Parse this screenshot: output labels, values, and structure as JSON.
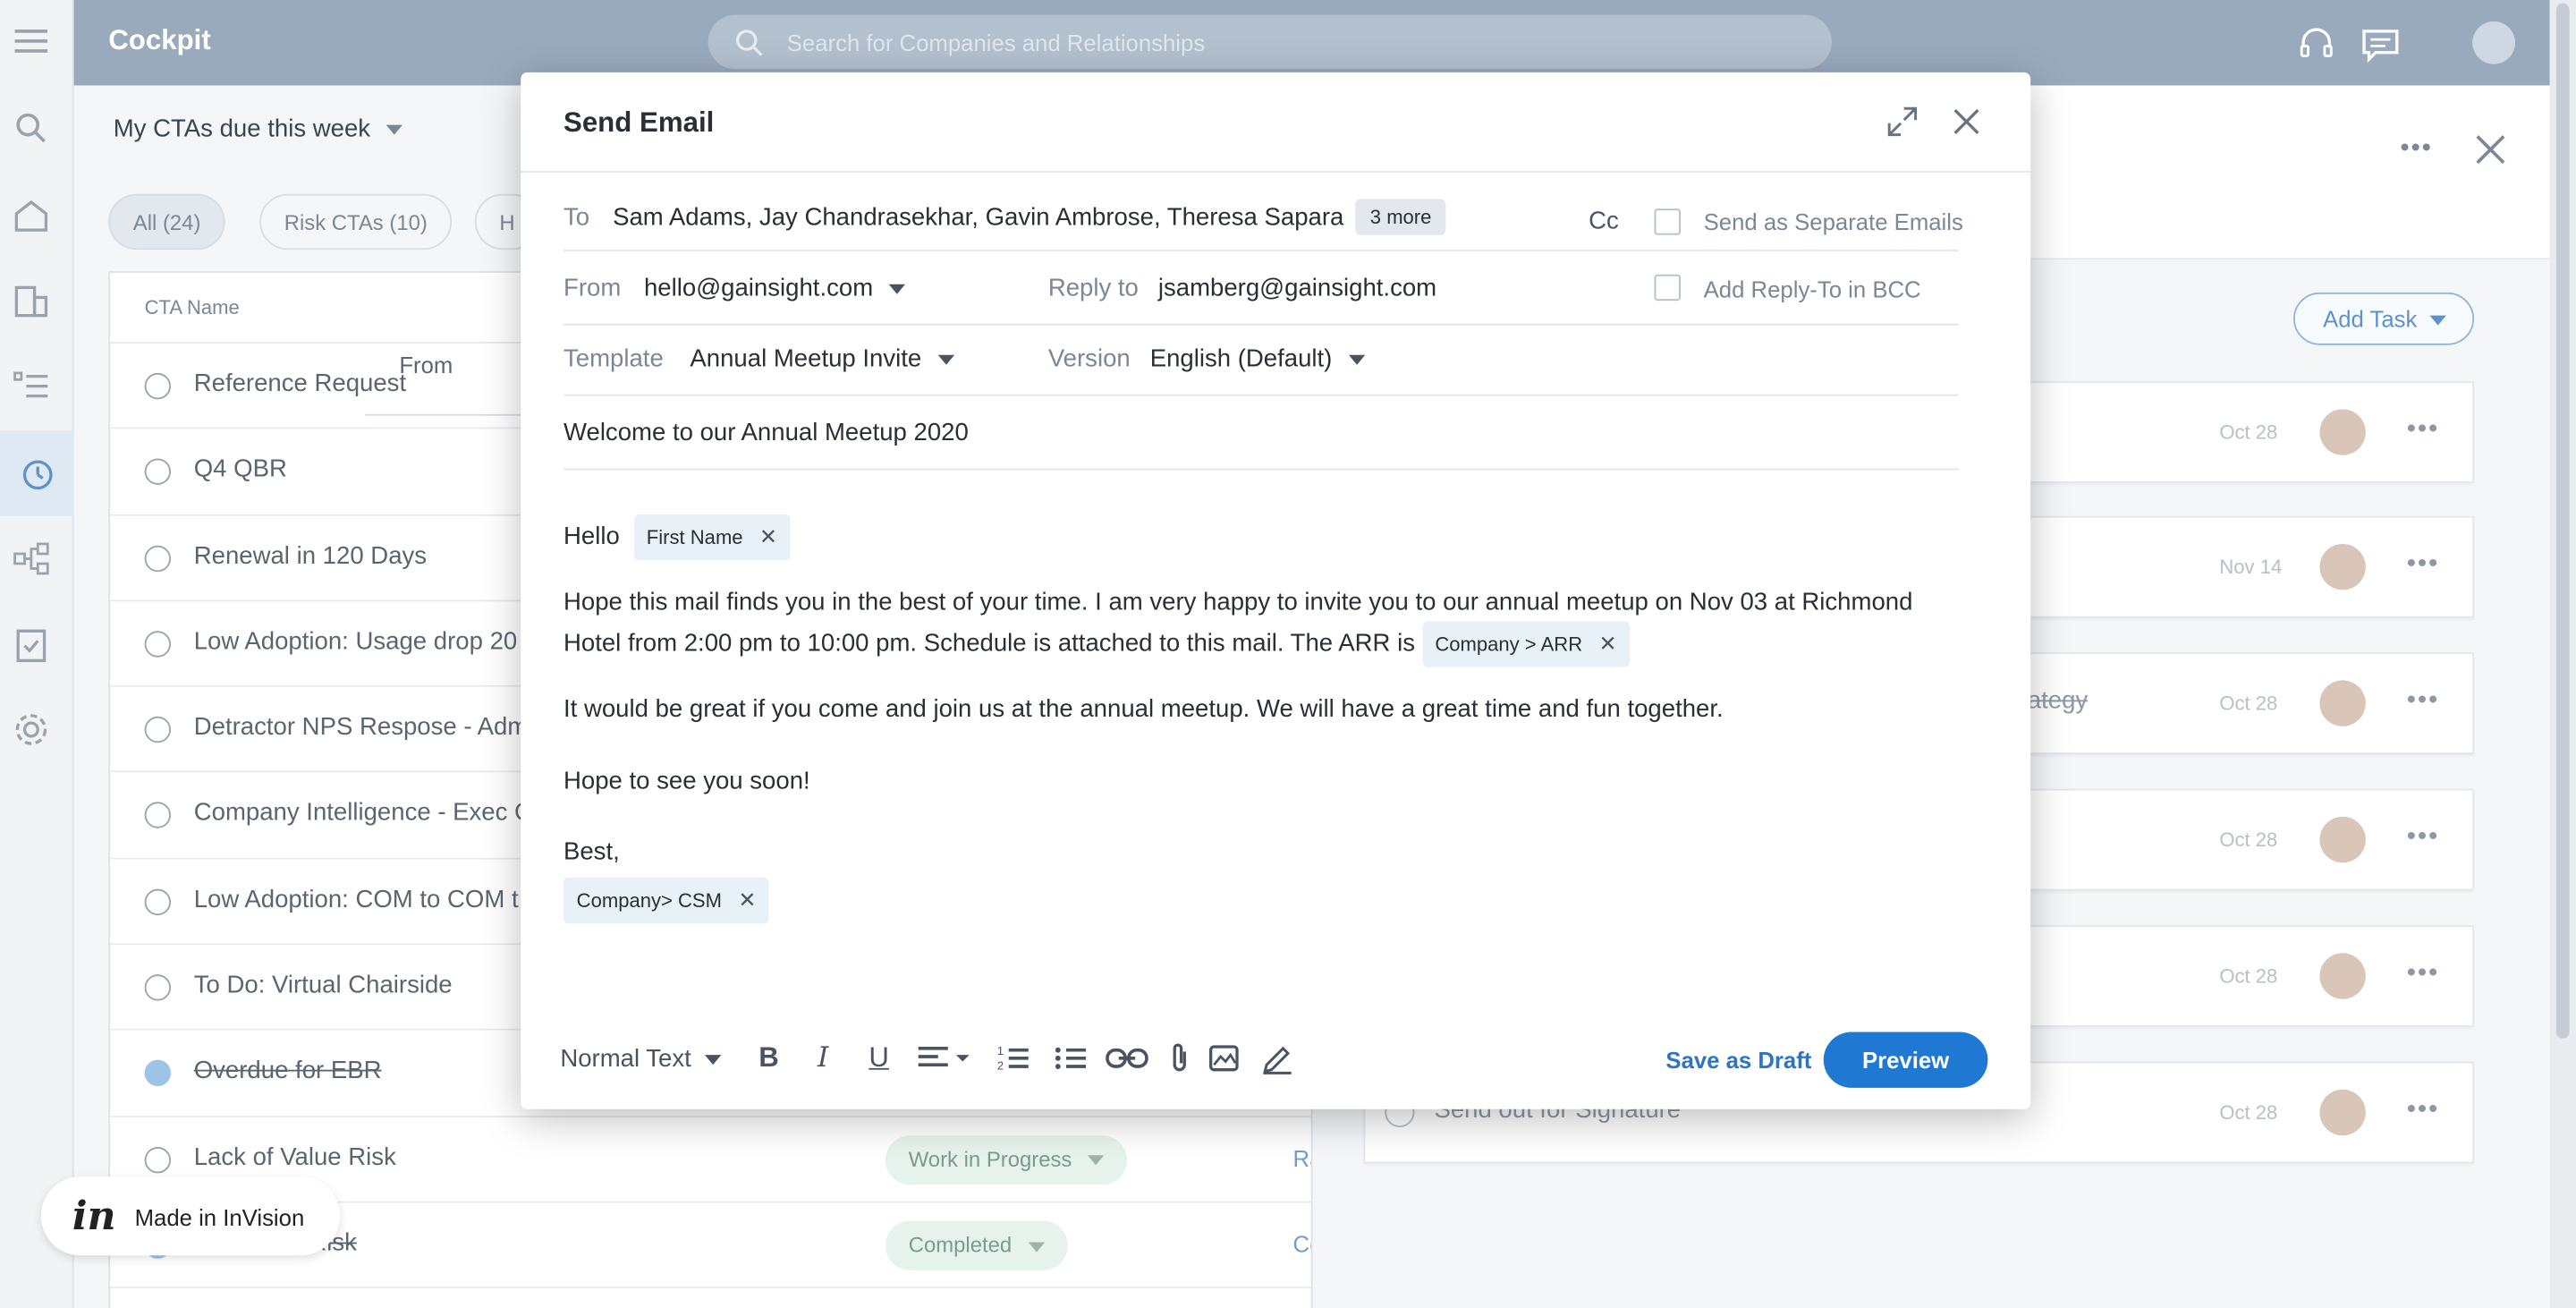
{
  "app": {
    "title": "Cockpit",
    "search_placeholder": "Search for Companies and Relationships"
  },
  "cockpit": {
    "view": "My CTAs due this week",
    "filters": [
      "All (24)",
      "Risk CTAs (10)",
      "H"
    ],
    "column_header": "CTA Name",
    "from_label": "From",
    "rows": [
      {
        "label": "Reference Request",
        "done": false
      },
      {
        "label": "Q4 QBR",
        "done": false
      },
      {
        "label": "Renewal in 120 Days",
        "done": false
      },
      {
        "label": "Low Adoption: Usage drop 20",
        "done": false
      },
      {
        "label": "Detractor NPS Respose - Adm",
        "done": false
      },
      {
        "label": "Company Intelligence - Exec C",
        "done": false
      },
      {
        "label": "Low Adoption: COM to COM t",
        "done": false
      },
      {
        "label": "To Do: Virtual Chairside",
        "done": false
      },
      {
        "label": "Overdue for EBR",
        "done": true
      },
      {
        "label": "Lack of Value Risk",
        "done": false,
        "status": "Work in Progress",
        "link": "Ra"
      },
      {
        "label": "Down-sell Risk",
        "done": true,
        "status": "Completed",
        "link": "Co"
      }
    ]
  },
  "tasks": {
    "add_task": "Add Task",
    "items": [
      {
        "label": "",
        "date": "Oct 28"
      },
      {
        "label": "",
        "date": "Nov 14"
      },
      {
        "label": "trategy",
        "date": "Oct 28"
      },
      {
        "label": "",
        "date": "Oct 28"
      },
      {
        "label": "",
        "date": "Oct 28"
      },
      {
        "label": "Send out for Signature",
        "date": "Oct 28"
      }
    ]
  },
  "modal": {
    "title": "Send Email",
    "to_label": "To",
    "to_value": "Sam Adams, Jay Chandrasekhar, Gavin Ambrose, Theresa Sapara",
    "more_chip": "3 more",
    "cc_label": "Cc",
    "separate_label": "Send as Separate Emails",
    "from_label": "From",
    "from_value": "hello@gainsight.com",
    "reply_label": "Reply to",
    "reply_value": "jsamberg@gainsight.com",
    "bcc_label": "Add Reply-To in BCC",
    "template_label": "Template",
    "template_value": "Annual Meetup Invite",
    "version_label": "Version",
    "version_value": "English (Default)",
    "subject": "Welcome to our Annual Meetup 2020",
    "body": {
      "hello": "Hello",
      "first_name_tag": "First Name",
      "p1": "Hope this mail finds you in the best of your time. I am very happy to invite you to our annual meetup on Nov 03 at Richmond Hotel from 2:00 pm to 10:00 pm. Schedule is attached to this mail. The ARR is",
      "arr_tag": "Company > ARR",
      "p2": "It would be great if you come and join us at the annual meetup. We will have a great time and fun together.",
      "p3": "Hope to see you soon!",
      "sign": "Best,",
      "csm_tag": "Company> CSM"
    },
    "toolbar": {
      "text_style": "Normal Text"
    },
    "save_draft": "Save as Draft",
    "preview": "Preview"
  },
  "invision": {
    "logo": "in",
    "label": "Made in InVision"
  }
}
